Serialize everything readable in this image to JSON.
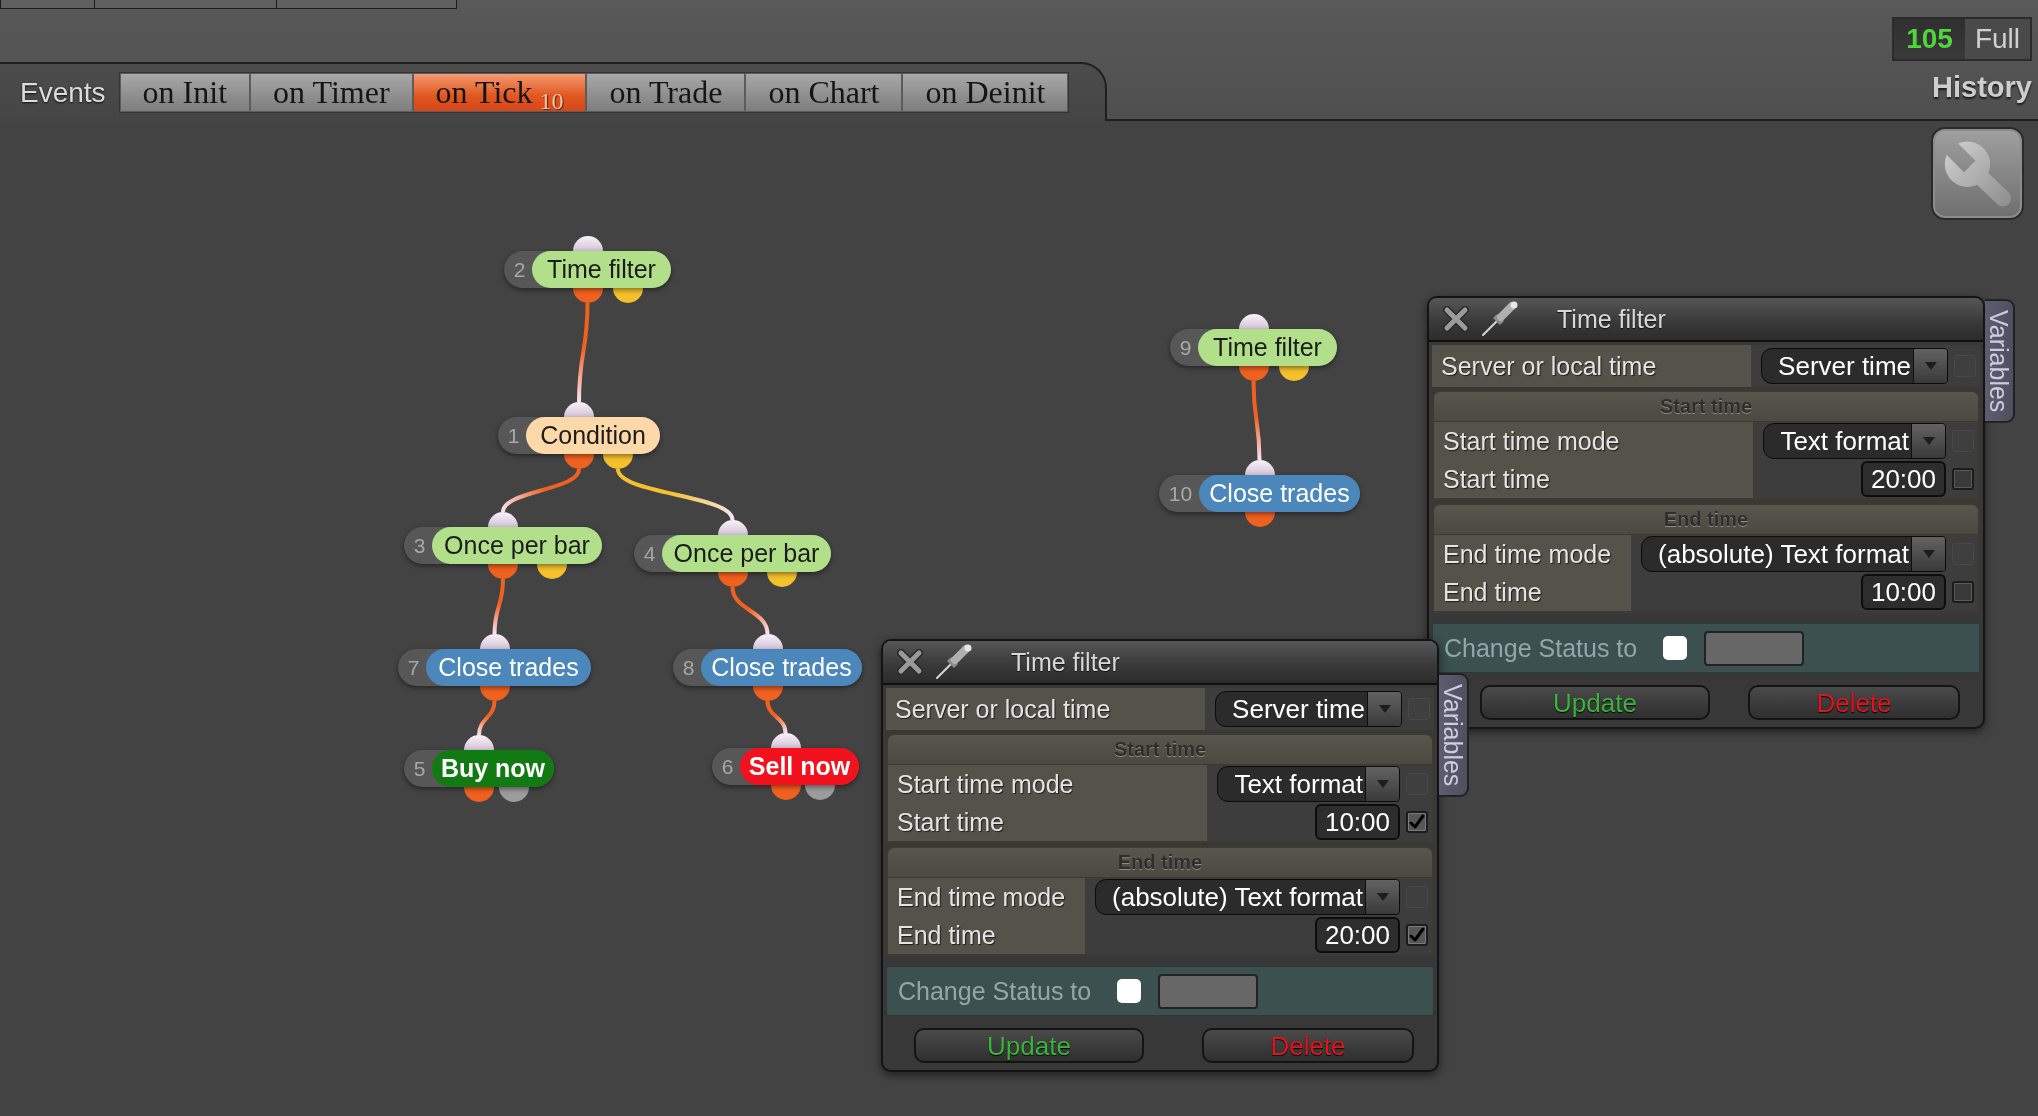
{
  "events_bar": {
    "label": "Events",
    "tabs": [
      {
        "label": "on Init",
        "selected": false
      },
      {
        "label": "on Timer",
        "selected": false
      },
      {
        "label": "on Tick",
        "badge": "10",
        "selected": true
      },
      {
        "label": "on Trade",
        "selected": false
      },
      {
        "label": "on Chart",
        "selected": false
      },
      {
        "label": "on Deinit",
        "selected": false
      }
    ]
  },
  "history": {
    "count": "105",
    "mode": "Full",
    "label": "History"
  },
  "graph": {
    "nodes": [
      {
        "number": "2",
        "label": "Time filter",
        "kind": "step",
        "color": "#b2e08a",
        "ports": [
          {
            "color": "#f0611f",
            "children": [
              {
                "number": "1",
                "label": "Condition",
                "kind": "step",
                "color": "#fdd8a9",
                "ports": [
                  {
                    "color": "#f0611f",
                    "children": [
                      {
                        "number": "3",
                        "label": "Once per bar",
                        "kind": "step",
                        "color": "#b2e08a",
                        "ports": [
                          {
                            "color": "#f0611f",
                            "children": [
                              {
                                "number": "7",
                                "label": "Close trades",
                                "kind": "step",
                                "color": "#4b87ba",
                                "ports": [
                                  {
                                    "color": "#f0611f",
                                    "children": [
                                      {
                                        "number": "5",
                                        "label": "Buy now",
                                        "kind": "order",
                                        "color": "#127a12",
                                        "ports": [
                                          {
                                            "color": "#f0611f"
                                          },
                                          {
                                            "color": "#9c9c9c"
                                          }
                                        ]
                                      }
                                    ]
                                  }
                                ]
                              }
                            ]
                          },
                          {
                            "color": "#f4c12c"
                          }
                        ]
                      }
                    ]
                  },
                  {
                    "color": "#f4c12c",
                    "children": [
                      {
                        "number": "4",
                        "label": "Once per bar",
                        "kind": "step",
                        "color": "#b2e08a",
                        "ports": [
                          {
                            "color": "#f0611f",
                            "children": [
                              {
                                "number": "8",
                                "label": "Close trades",
                                "kind": "step",
                                "color": "#4b87ba",
                                "ports": [
                                  {
                                    "color": "#f0611f",
                                    "children": [
                                      {
                                        "number": "6",
                                        "label": "Sell now",
                                        "kind": "order",
                                        "color": "#f2111d",
                                        "ports": [
                                          {
                                            "color": "#f0611f"
                                          },
                                          {
                                            "color": "#9c9c9c"
                                          }
                                        ]
                                      }
                                    ]
                                  }
                                ]
                              }
                            ]
                          },
                          {
                            "color": "#f4c12c"
                          }
                        ]
                      }
                    ]
                  }
                ]
              }
            ]
          },
          {
            "color": "#f4c12c"
          }
        ]
      },
      {
        "number": "9",
        "label": "Time filter",
        "kind": "step",
        "color": "#b2e08a",
        "ports": [
          {
            "color": "#f0611f",
            "children": [
              {
                "number": "10",
                "label": "Close trades",
                "kind": "step",
                "color": "#4b87ba",
                "ports": [
                  {
                    "color": "#f0611f"
                  }
                ]
              }
            ]
          },
          {
            "color": "#f4c12c"
          }
        ]
      }
    ]
  },
  "panels": [
    {
      "title": "Time filter",
      "sections": [
        {
          "rows": [
            {
              "label": "Server or local time",
              "kind": "dropdown",
              "value": "Server time",
              "checkbox": {
                "checked": false,
                "disabled": true
              }
            }
          ]
        },
        {
          "title": "Start time",
          "rows": [
            {
              "label": "Start time mode",
              "kind": "dropdown",
              "value": "Text format",
              "checkbox": {
                "checked": false,
                "disabled": true
              }
            },
            {
              "label": "Start time",
              "kind": "time",
              "value": "20:00",
              "checkbox": {
                "checked": false,
                "disabled": false
              }
            }
          ]
        },
        {
          "title": "End time",
          "rows": [
            {
              "label": "End time mode",
              "kind": "dropdown",
              "value": "(absolute) Text format",
              "checkbox": {
                "checked": false,
                "disabled": true
              }
            },
            {
              "label": "End time",
              "kind": "time",
              "value": "10:00",
              "checkbox": {
                "checked": false,
                "disabled": false
              }
            }
          ]
        }
      ],
      "status": {
        "label": "Change Status to",
        "checked": false
      },
      "buttons": [
        {
          "label": "Update",
          "kind": "update"
        },
        {
          "label": "Delete",
          "kind": "delete"
        }
      ],
      "side_tab": "Variables"
    },
    {
      "title": "Time filter",
      "sections": [
        {
          "rows": [
            {
              "label": "Server or local time",
              "kind": "dropdown",
              "value": "Server time",
              "checkbox": {
                "checked": false,
                "disabled": true
              }
            }
          ]
        },
        {
          "title": "Start time",
          "rows": [
            {
              "label": "Start time mode",
              "kind": "dropdown",
              "value": "Text format",
              "checkbox": {
                "checked": false,
                "disabled": true
              }
            },
            {
              "label": "Start time",
              "kind": "time",
              "value": "10:00",
              "checkbox": {
                "checked": true,
                "disabled": false
              }
            }
          ]
        },
        {
          "title": "End time",
          "rows": [
            {
              "label": "End time mode",
              "kind": "dropdown",
              "value": "(absolute) Text format",
              "checkbox": {
                "checked": false,
                "disabled": true
              }
            },
            {
              "label": "End time",
              "kind": "time",
              "value": "20:00",
              "checkbox": {
                "checked": true,
                "disabled": false
              }
            }
          ]
        }
      ],
      "status": {
        "label": "Change Status to",
        "checked": false
      },
      "buttons": [
        {
          "label": "Update",
          "kind": "update"
        },
        {
          "label": "Delete",
          "kind": "delete"
        }
      ],
      "side_tab": "Variables"
    }
  ]
}
